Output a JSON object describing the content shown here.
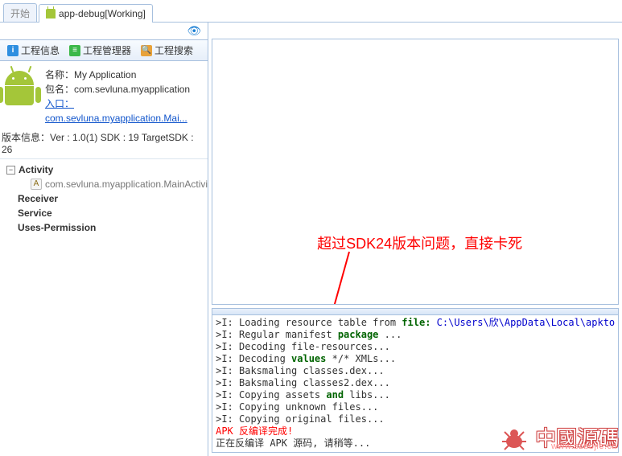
{
  "tabs": {
    "start": "开始",
    "working": "app-debug[Working]"
  },
  "toolbar": {
    "proj_info": "工程信息",
    "proj_mgr": "工程管理器",
    "proj_search": "工程搜索"
  },
  "info": {
    "name_lbl": "名称：",
    "name_val": "My Application",
    "pkg_lbl": "包名：",
    "pkg_val": "com.sevluna.myapplication",
    "entry_lbl": "入口：",
    "entry_val": "com.sevluna.myapplication.Mai...",
    "ver_lbl": "版本信息：",
    "ver_val": "Ver : 1.0(1) SDK : 19 TargetSDK : 26"
  },
  "tree": {
    "activity": "Activity",
    "activity_child_badge": "A",
    "activity_child": "com.sevluna.myapplication.MainActivi",
    "receiver": "Receiver",
    "service": "Service",
    "uses_perm": "Uses-Permission"
  },
  "annotation": "超过SDK24版本问题，直接卡死",
  "console": {
    "lines": [
      {
        "pre": ">I: ",
        "mid": "Loading resource table from ",
        "tail_kw": "file:",
        "tail_path": " C:\\Users\\欣\\AppData\\Local\\apkto"
      },
      {
        "pre": ">I: ",
        "mid": "Regular manifest ",
        "tail_kw": "package",
        "tail": " ..."
      },
      {
        "pre": ">I: ",
        "mid": "Decoding file-resources..."
      },
      {
        "pre": ">I: ",
        "mid": "Decoding ",
        "tail_kw": "values",
        "tail": " */* XMLs..."
      },
      {
        "pre": ">I: ",
        "mid": "Baksmaling classes.dex..."
      },
      {
        "pre": ">I: ",
        "mid": "Baksmaling classes2.dex..."
      },
      {
        "pre": ">I: ",
        "mid": "Copying assets ",
        "tail_kw": "and",
        "tail": " libs..."
      },
      {
        "pre": ">I: ",
        "mid": "Copying unknown files..."
      },
      {
        "pre": ">I: ",
        "mid": "Copying original files..."
      },
      {
        "done": "APK 反编译完成!"
      },
      {
        "plain": "正在反编译 APK 源码, 请稍等..."
      }
    ]
  },
  "watermark": {
    "text": "中國源碼",
    "url": "www.szbojie.cn"
  }
}
